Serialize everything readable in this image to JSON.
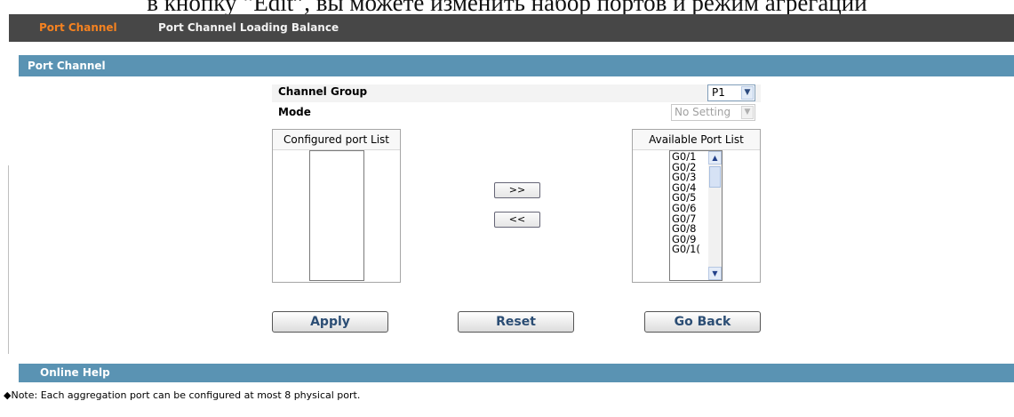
{
  "top_caption": "в кнопку “Edit”, вы можете изменить набор портов и режим агрегации",
  "nav": {
    "tabs": [
      {
        "label": "Port Channel",
        "active": true
      },
      {
        "label": "Port Channel Loading Balance",
        "active": false
      }
    ]
  },
  "panel": {
    "title": "Port Channel",
    "channel_group_label": "Channel Group",
    "channel_group_value": "P1",
    "mode_label": "Mode",
    "mode_value": "No Setting",
    "configured_list_title": "Configured port List",
    "available_list_title": "Available Port List",
    "available_ports": [
      "G0/1",
      "G0/2",
      "G0/3",
      "G0/4",
      "G0/5",
      "G0/6",
      "G0/7",
      "G0/8",
      "G0/9",
      "G0/1("
    ],
    "add_button": ">>",
    "remove_button": "<<",
    "apply_button": "Apply",
    "reset_button": "Reset",
    "go_back_button": "Go Back"
  },
  "help": {
    "title": "Online Help",
    "note": "◆Note: Each aggregation port can be configured at most 8 physical port."
  },
  "colors": {
    "nav_bg": "#474747",
    "nav_active": "#f58220",
    "header_blue": "#5a93b3",
    "button_text": "#2b4d74"
  }
}
